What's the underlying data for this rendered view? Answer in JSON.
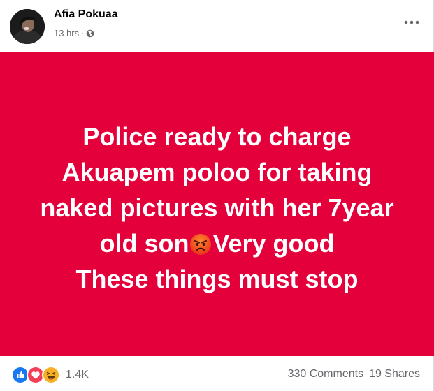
{
  "post": {
    "author": "Afia Pokuaa",
    "timestamp": "13 hrs",
    "separator": "·",
    "privacy_icon": "globe-icon",
    "more_icon": "more-options-icon",
    "background_color": "#e4003b",
    "text_lines": [
      "Police ready to charge",
      "Akuapem poloo for taking",
      "naked pictures with her 7year",
      "old son",
      "Very good",
      "These things must stop"
    ],
    "inline_emoji": "angry-face-emoji"
  },
  "footer": {
    "reactions": [
      "like-icon",
      "love-icon",
      "haha-icon"
    ],
    "reaction_count": "1.4K",
    "comments": "330 Comments",
    "shares": "19 Shares"
  },
  "colors": {
    "banner": "#e4003b",
    "secondary_text": "#65676b",
    "like_blue": "#1877f2",
    "love_red": "#f33e58",
    "haha_yellow": "#f7b125"
  }
}
